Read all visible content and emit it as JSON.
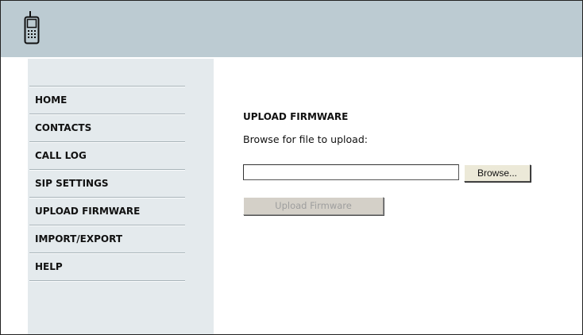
{
  "header": {
    "logo_icon": "mobile-phone-icon",
    "color": "#bccbd2"
  },
  "sidebar": {
    "items": [
      {
        "label": "HOME"
      },
      {
        "label": "CONTACTS"
      },
      {
        "label": "CALL LOG"
      },
      {
        "label": "SIP SETTINGS"
      },
      {
        "label": "UPLOAD FIRMWARE"
      },
      {
        "label": "IMPORT/EXPORT"
      },
      {
        "label": "HELP"
      }
    ]
  },
  "main": {
    "title": "UPLOAD FIRMWARE",
    "file_label": "Browse for file to upload:",
    "file_value": "",
    "browse_label": "Browse...",
    "upload_label": "Upload Firmware"
  }
}
